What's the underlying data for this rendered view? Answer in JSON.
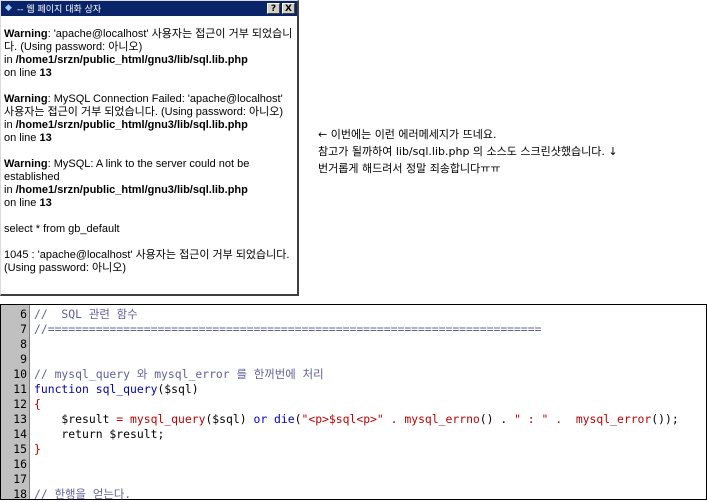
{
  "dialog": {
    "title": "-- 웹 페이지 대화 상자",
    "help_button": "?",
    "close_button": "X",
    "warnings": [
      {
        "label": "Warning",
        "message": ": 'apache@localhost' 사용자는 접근이 거부 되었습니다. (Using password: 아니오)",
        "in_prefix": "in ",
        "path": "/home1/srzn/public_html/gnu3/lib/sql.lib.php",
        "line_prefix": "on line ",
        "line_number": "13"
      },
      {
        "label": "Warning",
        "message": ": MySQL Connection Failed: 'apache@localhost' 사용자는 접근이 거부 되었습니다. (Using password: 아니오)",
        "in_prefix": "in ",
        "path": "/home1/srzn/public_html/gnu3/lib/sql.lib.php",
        "line_prefix": "on line ",
        "line_number": "13"
      },
      {
        "label": "Warning",
        "message": ": MySQL: A link to the server could not be established",
        "in_prefix": "in ",
        "path": "/home1/srzn/public_html/gnu3/lib/sql.lib.php",
        "line_prefix": "on line ",
        "line_number": "13"
      }
    ],
    "query": "select * from gb_default",
    "error": "1045 : 'apache@localhost' 사용자는 접근이 거부 되었습니다. (Using password: 아니오)"
  },
  "note": {
    "line1": "← 이번에는 이런 에러메세지가 뜨네요.",
    "line2": "참고가 될까하여 lib/sql.lib.php 의 소스도 스크린샷했습니다. ↓",
    "line3": "번거롭게 해드려서 정말 죄송합니다ㅠㅠ"
  },
  "code": {
    "line_numbers": [
      "6",
      "7",
      "8",
      "9",
      "10",
      "11",
      "12",
      "13",
      "14",
      "15",
      "16",
      "17",
      "18"
    ],
    "l6": "//  SQL 관련 함수",
    "l7": "//========================================================================",
    "l10": "// mysql_query 와 mysql_error 를 한꺼번에 처리",
    "l11_kw": "function",
    "l11_name": " sql_query",
    "l11_args": "($sql)",
    "l12": "{",
    "l13_a": "    $result ",
    "l13_eq": "=",
    "l13_fn": " mysql_query",
    "l13_b": "($sql) ",
    "l13_or": "or",
    "l13_die": " die",
    "l13_c": "(",
    "l13_s1": "\"<p>$sql<p>\"",
    "l13_dot1": " . ",
    "l13_errno": "mysql_errno",
    "l13_d": "() . ",
    "l13_s2": "\" : \"",
    "l13_dot2": " .  ",
    "l13_error": "mysql_error",
    "l13_e": "());",
    "l14": "    return $result;",
    "l15": "}",
    "l18": "// 한행을 얻는다."
  }
}
